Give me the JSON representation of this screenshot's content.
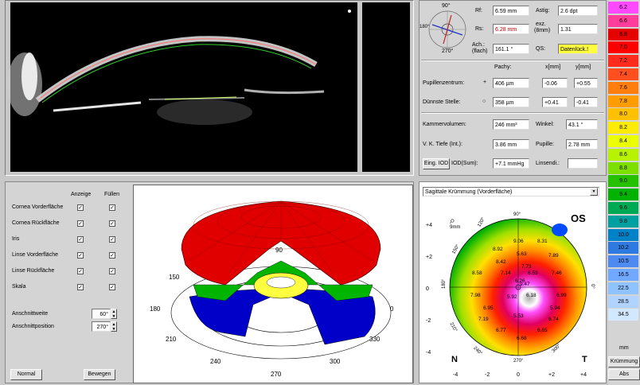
{
  "scheimpflug": {
    "label": "scheimpflug-image"
  },
  "params": {
    "rf": {
      "label": "Rf:",
      "value": "6.59 mm"
    },
    "astig": {
      "label": "Astig:",
      "value": "2.6 dpt"
    },
    "rs": {
      "label": "Rs:",
      "value": "6.28 mm"
    },
    "exz": {
      "label1": "exz.",
      "label2": "(8mm)",
      "value": "1.31"
    },
    "ach": {
      "label1": "Ach.:",
      "label2": "(flach)",
      "value": "161.1 °"
    },
    "qs": {
      "label": "QS:",
      "value": "Datenlück.!"
    },
    "compass": {
      "top": "90°",
      "left": "180°",
      "bottom": "270°"
    },
    "col_pachy": "Pachy:",
    "col_x": "x[mm]",
    "col_y": "y[mm]",
    "pupil": {
      "label": "Pupillenzentrum:",
      "marker": "+",
      "pachy": "406 µm",
      "x": "-0.06",
      "y": "+0.55"
    },
    "thin": {
      "label": "Dünnste Stelle:",
      "marker": "○",
      "pachy": "358 µm",
      "x": "+0.41",
      "y": "-0.41"
    },
    "kammer": {
      "label": "Kammervolumen:",
      "value": "246 mm³"
    },
    "winkel": {
      "label": "Winkel:",
      "value": "43.1 °"
    },
    "vk": {
      "label": "V. K. Tiefe (Int.):",
      "value": "3.86 mm"
    },
    "pupille": {
      "label": "Pupille:",
      "value": "2.78 mm"
    },
    "iod_button": "Eing. IOD",
    "iod_label": "IOD(Sum):",
    "iod_value": "+7.1 mmHg",
    "linsendi_label": "Linsendi.:",
    "linsendi_value": ""
  },
  "model3d": {
    "col_anzeige": "Anzeige",
    "col_fuellen": "Füllen",
    "rows": [
      {
        "label": "Cornea Vorderfläche",
        "anzeige": "✓",
        "fuellen": "✓"
      },
      {
        "label": "Cornea Rückfläche",
        "anzeige": "✓",
        "fuellen": "✓"
      },
      {
        "label": "Iris",
        "anzeige": "✓",
        "fuellen": "✓"
      },
      {
        "label": "Linse Vorderfläche",
        "anzeige": "✓",
        "fuellen": "✓"
      },
      {
        "label": "Linse Rückfläche",
        "anzeige": "✓",
        "fuellen": "✓"
      },
      {
        "label": "Skala",
        "anzeige": "✓",
        "fuellen": "✓"
      }
    ],
    "anschnittweite_label": "Anschnittweite",
    "anschnittweite_value": "60°",
    "anschnittposition_label": "Anschnittposition",
    "anschnittposition_value": "270°",
    "normal_button": "Normal",
    "bewegen_button": "Bewegen",
    "angles": {
      "a0": "0",
      "a90": "90",
      "a150": "150",
      "a180": "180",
      "a210": "210",
      "a240": "240",
      "a270": "270",
      "a300": "300",
      "a330": "330"
    }
  },
  "topo": {
    "dropdown": "Sagittale Krümmung (Vorderfläche)",
    "zoom": "9mm",
    "eye": "OS",
    "n_label": "N",
    "t_label": "T",
    "angle_90": "90°",
    "angle_120": "120°",
    "angle_150": "150°",
    "angle_180": "180°",
    "angle_210": "210°",
    "angle_240": "240°",
    "angle_270": "270°",
    "angle_300": "300°",
    "angle_0": "0°",
    "angle_60": "60°",
    "y_ticks": [
      "+4",
      "+2",
      "0",
      "-2",
      "-4"
    ],
    "x_ticks": [
      "-4",
      "-2",
      "0",
      "+2",
      "+4"
    ],
    "values": [
      "9.06",
      "8.31",
      "8.92",
      "5.63",
      "7.89",
      "8.42",
      "7.73",
      "8.58",
      "7.14",
      "6.53",
      "7.46",
      "6.26",
      "9.47",
      "7.98",
      "5.92",
      "6.18",
      "6.99",
      "6.95",
      "5.94",
      "7.19",
      "5.53",
      "6.74",
      "6.77",
      "6.65",
      "6.68"
    ]
  },
  "scale": {
    "values": [
      "6.2",
      "6.6",
      "6.8",
      "7.0",
      "7.2",
      "7.4",
      "7.6",
      "7.8",
      "8.0",
      "8.2",
      "8.4",
      "8.6",
      "8.8",
      "9.0",
      "9.4",
      "9.6",
      "9.8",
      "10.0",
      "10.2",
      "10.5",
      "16.5",
      "22.5",
      "28.5",
      "34.5"
    ],
    "colors": [
      "#ff49ff",
      "#ff3d9a",
      "#e60000",
      "#ff0000",
      "#ff2b1c",
      "#ff4f1f",
      "#ff7e0e",
      "#ff9d00",
      "#ffc000",
      "#ffeb00",
      "#ecff00",
      "#b7f200",
      "#7de000",
      "#25c000",
      "#00b200",
      "#00aa55",
      "#00a0a0",
      "#0082c8",
      "#2f7ae0",
      "#4f8af0",
      "#70a9ff",
      "#8fc3ff",
      "#b0d4ff",
      "#d2e8ff"
    ],
    "unit": "mm",
    "mode": "Krümmung",
    "abs": "Abs"
  }
}
